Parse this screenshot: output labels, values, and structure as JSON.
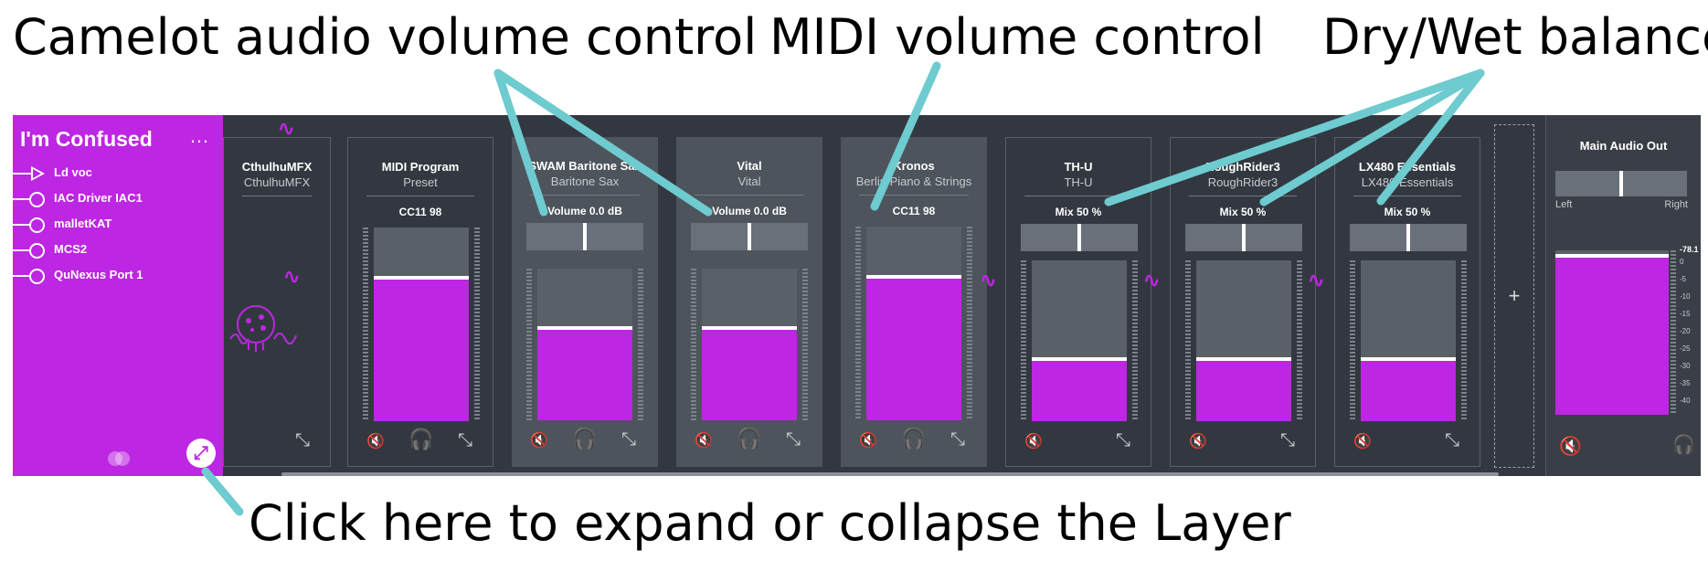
{
  "annotations": {
    "camelot_volume": "Camelot audio volume control",
    "midi_volume": "MIDI volume control",
    "dry_wet": "Dry/Wet balance",
    "expand": "Click here to expand or collapse the Layer"
  },
  "layer": {
    "title": "I'm Confused",
    "menu": "…",
    "midi_inputs": [
      "Ld voc",
      "IAC Driver IAC1",
      "malletKAT",
      "MCS2",
      "QuNexus Port 1"
    ],
    "expand_icon": "expand-icon",
    "expand_glyph": "⤢"
  },
  "strips": [
    {
      "name": "CthulhuMFX",
      "preset": "CthulhuMFX",
      "control": "",
      "kind": "plugin"
    },
    {
      "name": "MIDI Program",
      "preset": "Preset",
      "control": "CC11 98",
      "level": 0.75,
      "kind": "midi"
    },
    {
      "name": "SWAM Baritone Sax",
      "preset": "Baritone Sax",
      "control": "Volume 0.0 dB",
      "pos": 0.5,
      "level": 0.62,
      "kind": "instrument"
    },
    {
      "name": "Vital",
      "preset": "Vital",
      "control": "Volume 0.0 dB",
      "pos": 0.5,
      "level": 0.62,
      "kind": "instrument"
    },
    {
      "name": "Kronos",
      "preset": "Berlin Piano & Strings",
      "control": "CC11 98",
      "level": 0.75,
      "kind": "midi"
    },
    {
      "name": "TH-U",
      "preset": "TH-U",
      "control": "Mix 50 %",
      "pos": 0.5,
      "level": 0.4,
      "kind": "effect"
    },
    {
      "name": "RoughRider3",
      "preset": "RoughRider3",
      "control": "Mix 50 %",
      "pos": 0.5,
      "level": 0.4,
      "kind": "effect"
    },
    {
      "name": "LX480 Essentials",
      "preset": "LX480 Essentials",
      "control": "Mix 50 %",
      "pos": 0.5,
      "level": 0.4,
      "kind": "effect"
    }
  ],
  "add_label": "+",
  "main_out": {
    "title": "Main Audio Out",
    "left": "Left",
    "right": "Right",
    "peak": "-78.1",
    "scale": [
      "0",
      "-5",
      "-10",
      "-15",
      "-20",
      "-25",
      "-30",
      "-35",
      "-40"
    ],
    "level": 0.98,
    "pan": 0.5
  },
  "icons": {
    "mute": "🔇",
    "headphones": "🎧",
    "expand": "⤡"
  },
  "colors": {
    "accent": "#bd26e2",
    "annotation_line": "#6ecbd0",
    "background": "#333840"
  }
}
